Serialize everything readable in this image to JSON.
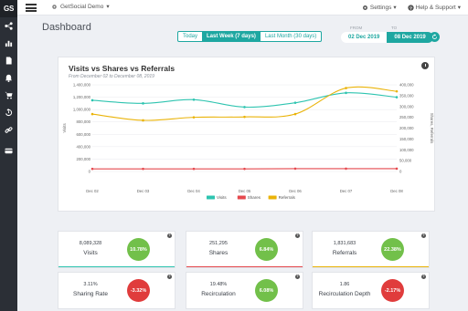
{
  "app": {
    "logo": "GS",
    "account": "GetSocial Demo",
    "settings_label": "Settings",
    "help_label": "Help & Support"
  },
  "sidebar": {
    "items": [
      {
        "icon": "share-icon"
      },
      {
        "icon": "bar-chart-icon"
      },
      {
        "icon": "document-icon"
      },
      {
        "icon": "bell-icon"
      },
      {
        "icon": "cart-icon"
      },
      {
        "icon": "history-icon"
      },
      {
        "icon": "link-icon"
      },
      {
        "icon": "card-icon"
      }
    ]
  },
  "header": {
    "title": "Dashboard",
    "ranges": [
      "Today",
      "Last Week (7 days)",
      "Last Month (30 days)"
    ],
    "active_range": 1,
    "from_label": "FROM",
    "to_label": "TO",
    "from_date": "02 Dec 2019",
    "to_date": "08 Dec 2019"
  },
  "chart": {
    "title": "Visits vs Shares vs Referrals",
    "subtitle": "From December 02 to December 08, 2019",
    "left_axis_label": "Visits",
    "right_axis_label": "Shares, Referrals"
  },
  "chart_data": {
    "type": "line",
    "categories": [
      "Dec 02",
      "Dec 03",
      "Dec 04",
      "Dec 05",
      "Dec 06",
      "Dec 07",
      "Dec 08"
    ],
    "series": [
      {
        "name": "Visits",
        "axis": "left",
        "color": "#2ec4b0",
        "values": [
          1150000,
          1100000,
          1160000,
          1040000,
          1110000,
          1270000,
          1200000
        ]
      },
      {
        "name": "Shares",
        "axis": "right",
        "color": "#e5484d",
        "values": [
          12000,
          12000,
          12000,
          12000,
          13000,
          13000,
          13000
        ]
      },
      {
        "name": "Referrals",
        "axis": "right",
        "color": "#eab308",
        "values": [
          265000,
          236000,
          250000,
          252000,
          265000,
          385000,
          370000
        ]
      }
    ],
    "ylim_left": [
      0,
      1400000
    ],
    "ylim_right": [
      0,
      400000
    ],
    "yticks_left": [
      "0",
      "200,000",
      "400,000",
      "600,000",
      "800,000",
      "1,000,000",
      "1,200,000",
      "1,400,000"
    ],
    "yticks_right": [
      "0",
      "50,000",
      "100,000",
      "150,000",
      "200,000",
      "250,000",
      "300,000",
      "350,000",
      "400,000"
    ],
    "legend_position": "bottom",
    "grid": true
  },
  "stats": [
    {
      "value": "8,089,328",
      "label": "Visits",
      "change": "10.78%",
      "color": "#72c04a",
      "bar": "#2ec4b0"
    },
    {
      "value": "251,295",
      "label": "Shares",
      "change": "6.84%",
      "color": "#72c04a",
      "bar": "#e5484d"
    },
    {
      "value": "1,831,683",
      "label": "Referrals",
      "change": "22.38%",
      "color": "#72c04a",
      "bar": "#eab308"
    },
    {
      "value": "3.11%",
      "label": "Sharing Rate",
      "change": "-3.32%",
      "color": "#e03c3c",
      "bar": ""
    },
    {
      "value": "19.48%",
      "label": "Recirculation",
      "change": "6.08%",
      "color": "#72c04a",
      "bar": ""
    },
    {
      "value": "1.86",
      "label": "Recirculation Depth",
      "change": "-2.17%",
      "color": "#e03c3c",
      "bar": ""
    }
  ]
}
